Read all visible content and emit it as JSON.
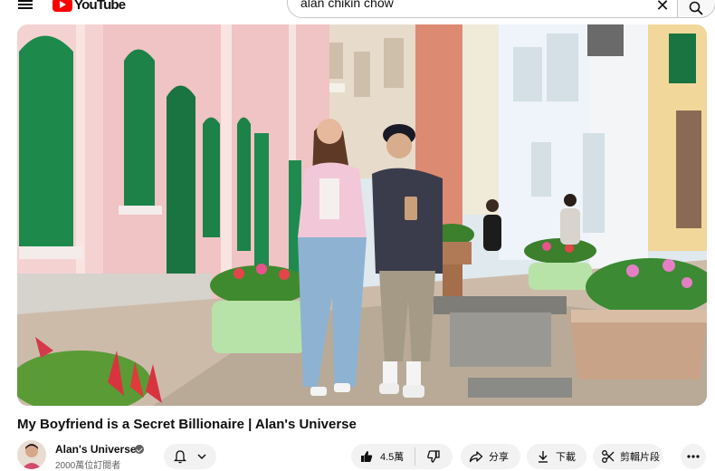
{
  "header": {
    "logo_text": "YouTube",
    "search_query": "alan chikin chow"
  },
  "video": {
    "title": "My Boyfriend is a Secret Billionaire | Alan's Universe"
  },
  "channel": {
    "name": "Alan's Universe",
    "subscribers": "2000萬位訂閱者"
  },
  "actions": {
    "like_count": "4.5萬",
    "share_label": "分享",
    "download_label": "下載",
    "clip_label": "剪輯片段"
  },
  "colors": {
    "brand_red": "#ff0000",
    "pill_bg": "#f2f2f2",
    "text_primary": "#0f0f0f",
    "text_secondary": "#606060"
  }
}
